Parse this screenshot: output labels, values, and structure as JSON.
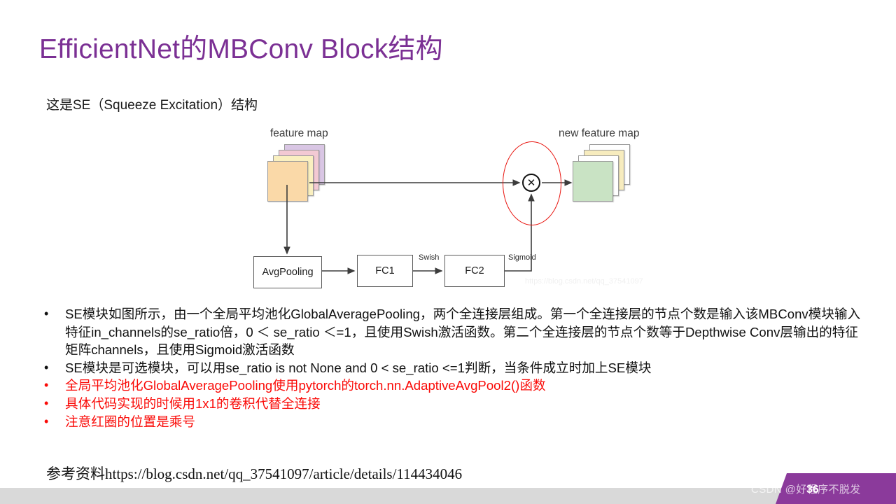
{
  "slide": {
    "title": "EfficientNet的MBConv Block结构",
    "subtitle": "这是SE（Squeeze Excitation）结构",
    "title_color": "#7B3094",
    "body_text_color": "#111111",
    "highlight_color": "#fa0a07",
    "background": "#ffffff"
  },
  "diagram": {
    "input_label": "feature map",
    "output_label": "new feature map",
    "nodes": [
      {
        "id": "avgpool",
        "label": "AvgPooling"
      },
      {
        "id": "fc1",
        "label": "FC1"
      },
      {
        "id": "fc2",
        "label": "FC2"
      }
    ],
    "edge_labels": [
      {
        "id": "swish",
        "label": "Swish"
      },
      {
        "id": "sigmoid",
        "label": "Sigmoid"
      }
    ],
    "multiply_symbol": "✕",
    "input_stack_colors": [
      "#d9c6e4",
      "#f3c9d3",
      "#faf0c0",
      "#fad9a8"
    ],
    "output_stack_colors": [
      "#ffffff",
      "#f7ecbe",
      "#ffffff",
      "#c9e3c4"
    ],
    "highlight_ellipse_color": "#e8150f",
    "watermark": "https://blog.csdn.net/qq_37541097"
  },
  "bullets": [
    {
      "color": "black",
      "text": "SE模块如图所示，由一个全局平均池化GlobalAveragePooling，两个全连接层组成。第一个全连接层的节点个数是输入该MBConv模块输入特征in_channels的se_ratio倍，0 ＜ se_ratio ＜=1，且使用Swish激活函数。第二个全连接层的节点个数等于Depthwise Conv层输出的特征矩阵channels，且使用Sigmoid激活函数"
    },
    {
      "color": "black",
      "text": "SE模块是可选模块，可以用se_ratio is not None and 0 < se_ratio <=1判断，当条件成立时加上SE模块"
    },
    {
      "color": "red",
      "text": "全局平均池化GlobalAveragePooling使用pytorch的torch.nn.AdaptiveAvgPool2()函数"
    },
    {
      "color": "red",
      "text": "具体代码实现的时候用1x1的卷积代替全连接"
    },
    {
      "color": "red",
      "text": "注意红圈的位置是乘号"
    }
  ],
  "reference": "参考资料https://blog.csdn.net/qq_37541097/article/details/114434046",
  "footer": {
    "watermark": "CSDN @好程序不脱发",
    "page_number": "36",
    "band_color": "#d9d9d9",
    "banner_color": "#8B3A9B"
  }
}
